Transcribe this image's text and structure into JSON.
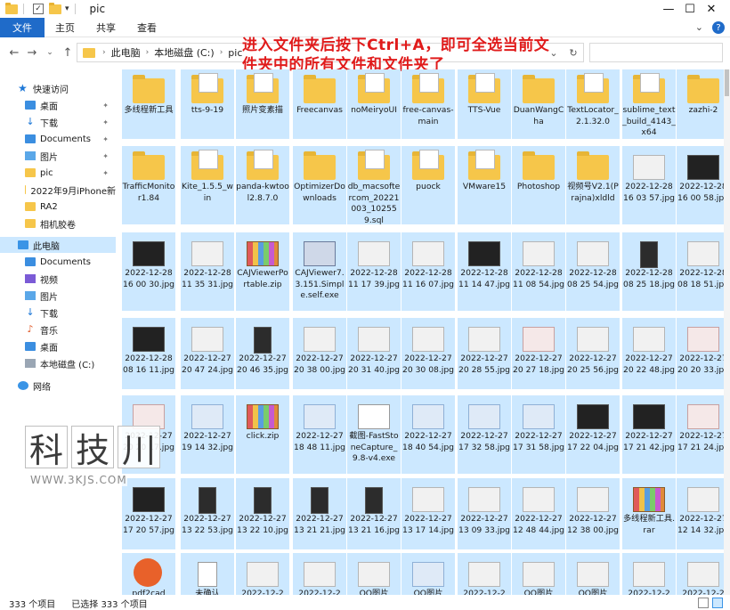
{
  "window": {
    "title": "pic",
    "controls": {
      "minimize": "—",
      "maximize": "☐",
      "close": "✕"
    }
  },
  "ribbon": {
    "tabs": [
      {
        "label": "文件"
      },
      {
        "label": "主页"
      },
      {
        "label": "共享"
      },
      {
        "label": "查看"
      }
    ],
    "expand": "⌄",
    "help": "?"
  },
  "address": {
    "crumbs": [
      "此电脑",
      "本地磁盘 (C:)",
      "pic"
    ],
    "dropdown": "⌄",
    "refresh": "↻",
    "search_placeholder": ""
  },
  "annotation": "进入文件夹后按下Ctrl+A，即可全选当前文件夹中的所有文件和文件夹了",
  "nav": {
    "quick_access": "快速访问",
    "pinned": [
      {
        "label": "桌面",
        "icon": "desktop-icon"
      },
      {
        "label": "下载",
        "icon": "download-icon"
      },
      {
        "label": "Documents",
        "icon": "documents-icon"
      },
      {
        "label": "图片",
        "icon": "pictures-icon"
      },
      {
        "label": "pic",
        "icon": "folder-icon"
      },
      {
        "label": "2022年9月iPhone新",
        "icon": "folder-icon"
      },
      {
        "label": "RA2",
        "icon": "folder-icon"
      },
      {
        "label": "相机胶卷",
        "icon": "folder-icon"
      }
    ],
    "this_pc": "此电脑",
    "pc_items": [
      {
        "label": "Documents",
        "icon": "documents-icon"
      },
      {
        "label": "视频",
        "icon": "videos-icon"
      },
      {
        "label": "图片",
        "icon": "pictures-icon"
      },
      {
        "label": "下载",
        "icon": "download-icon"
      },
      {
        "label": "音乐",
        "icon": "music-icon"
      },
      {
        "label": "桌面",
        "icon": "desktop-icon"
      },
      {
        "label": "本地磁盘 (C:)",
        "icon": "drive-icon"
      }
    ],
    "network": "网络"
  },
  "files": [
    [
      "多线程新工具",
      "tts-9-19",
      "照片变素描",
      "Freecanvas",
      "noMeiryoUI",
      "free-canvas-main",
      "TTS-Vue",
      "DuanWangCha",
      "TextLocator_2.1.32.0",
      "sublime_text_build_4143_x64",
      "zazhi-2"
    ],
    [
      "TrafficMonitor1.84",
      "Kite_1.5.5_win",
      "panda-kwtool2.8.7.0",
      "OptimizerDownloads",
      "db_macsoftercom_20221003_102559.sql",
      "puock",
      "VMware15",
      "Photoshop",
      "视频号V2.1(Prajna)xldld",
      "2022-12-28 16 03 57.jpg",
      "2022-12-28 16 00 58.jpg"
    ],
    [
      "2022-12-28 16 00 30.jpg",
      "2022-12-28 11 35 31.jpg",
      "CAJViewerPortable.zip",
      "CAJViewer7.3.151.Simple.self.exe",
      "2022-12-28 11 17 39.jpg",
      "2022-12-28 11 16 07.jpg",
      "2022-12-28 11 14 47.jpg",
      "2022-12-28 11 08 54.jpg",
      "2022-12-28 08 25 54.jpg",
      "2022-12-28 08 25 18.jpg",
      "2022-12-28 08 18 51.jpg"
    ],
    [
      "2022-12-28 08 16 11.jpg",
      "2022-12-27 20 47 24.jpg",
      "2022-12-27 20 46 35.jpg",
      "2022-12-27 20 38 00.jpg",
      "2022-12-27 20 31 40.jpg",
      "2022-12-27 20 30 08.jpg",
      "2022-12-27 20 28 55.jpg",
      "2022-12-27 20 27 18.jpg",
      "2022-12-27 20 25 56.jpg",
      "2022-12-27 20 22 48.jpg",
      "2022-12-27 20 20 33.jpg"
    ],
    [
      "2022-12-27 20 20 17.jpg",
      "2022-12-27 19 14 32.jpg",
      "click.zip",
      "2022-12-27 18 48 11.jpg",
      "截图-FastStoneCapture_9.8-v4.exe",
      "2022-12-27 18 40 54.jpg",
      "2022-12-27 17 32 58.jpg",
      "2022-12-27 17 31 58.jpg",
      "2022-12-27 17 22 04.jpg",
      "2022-12-27 17 21 42.jpg",
      "2022-12-27 17 21 24.jpg"
    ],
    [
      "2022-12-27 17 20 57.jpg",
      "2022-12-27 13 22 53.jpg",
      "2022-12-27 13 22 10.jpg",
      "2022-12-27 13 21 21.jpg",
      "2022-12-27 13 21 16.jpg",
      "2022-12-27 13 17 14.jpg",
      "2022-12-27 13 09 33.jpg",
      "2022-12-27 12 48 44.jpg",
      "2022-12-27 12 38 00.jpg",
      "多线程新工具.rar",
      "2022-12-27 12 14 32.jpg"
    ],
    [
      "pdf2cad",
      "未确认",
      "2022-12-2",
      "2022-12-2",
      "QQ图片",
      "QQ图片",
      "2022-12-2",
      "QQ图片",
      "QQ图片",
      "2022-12-2",
      "2022-12-2"
    ]
  ],
  "file_kinds": [
    [
      "folder",
      "folder-doc",
      "folder-doc",
      "folder",
      "folder-doc",
      "folder-doc",
      "folder-doc",
      "folder",
      "folder-doc",
      "folder-doc",
      "folder"
    ],
    [
      "folder",
      "folder-doc",
      "folder-doc",
      "folder",
      "folder-doc",
      "folder-doc",
      "folder-doc",
      "folder",
      "folder",
      "img",
      "img-dark"
    ],
    [
      "img-dark",
      "img",
      "rar",
      "exe",
      "img",
      "img",
      "img-dark",
      "img",
      "img",
      "img-phone",
      "img"
    ],
    [
      "img-dark",
      "img",
      "img-phone",
      "img",
      "img",
      "img",
      "img",
      "img-red",
      "img",
      "img",
      "img-red"
    ],
    [
      "img-red",
      "img-blue",
      "rar",
      "img-blue",
      "snip",
      "img-blue",
      "img-blue",
      "img-blue",
      "img-dark",
      "img-dark",
      "img-red"
    ],
    [
      "img-dark",
      "img-phone",
      "img-phone",
      "img-phone",
      "img-phone",
      "img",
      "img",
      "img",
      "img",
      "rar",
      "img"
    ],
    [
      "cad",
      "doc-blank",
      "img",
      "img",
      "img",
      "img-blue",
      "img",
      "img",
      "img",
      "img",
      "img"
    ]
  ],
  "watermark": {
    "chars": [
      "科",
      "技",
      "川"
    ],
    "url": "WWW.3KJS.COM"
  },
  "status": {
    "count": "333 个项目",
    "selected": "已选择 333 个项目"
  },
  "colors": {
    "selection": "#cce8ff",
    "accent": "#1f6bc9",
    "annotation": "#e01b1b"
  }
}
